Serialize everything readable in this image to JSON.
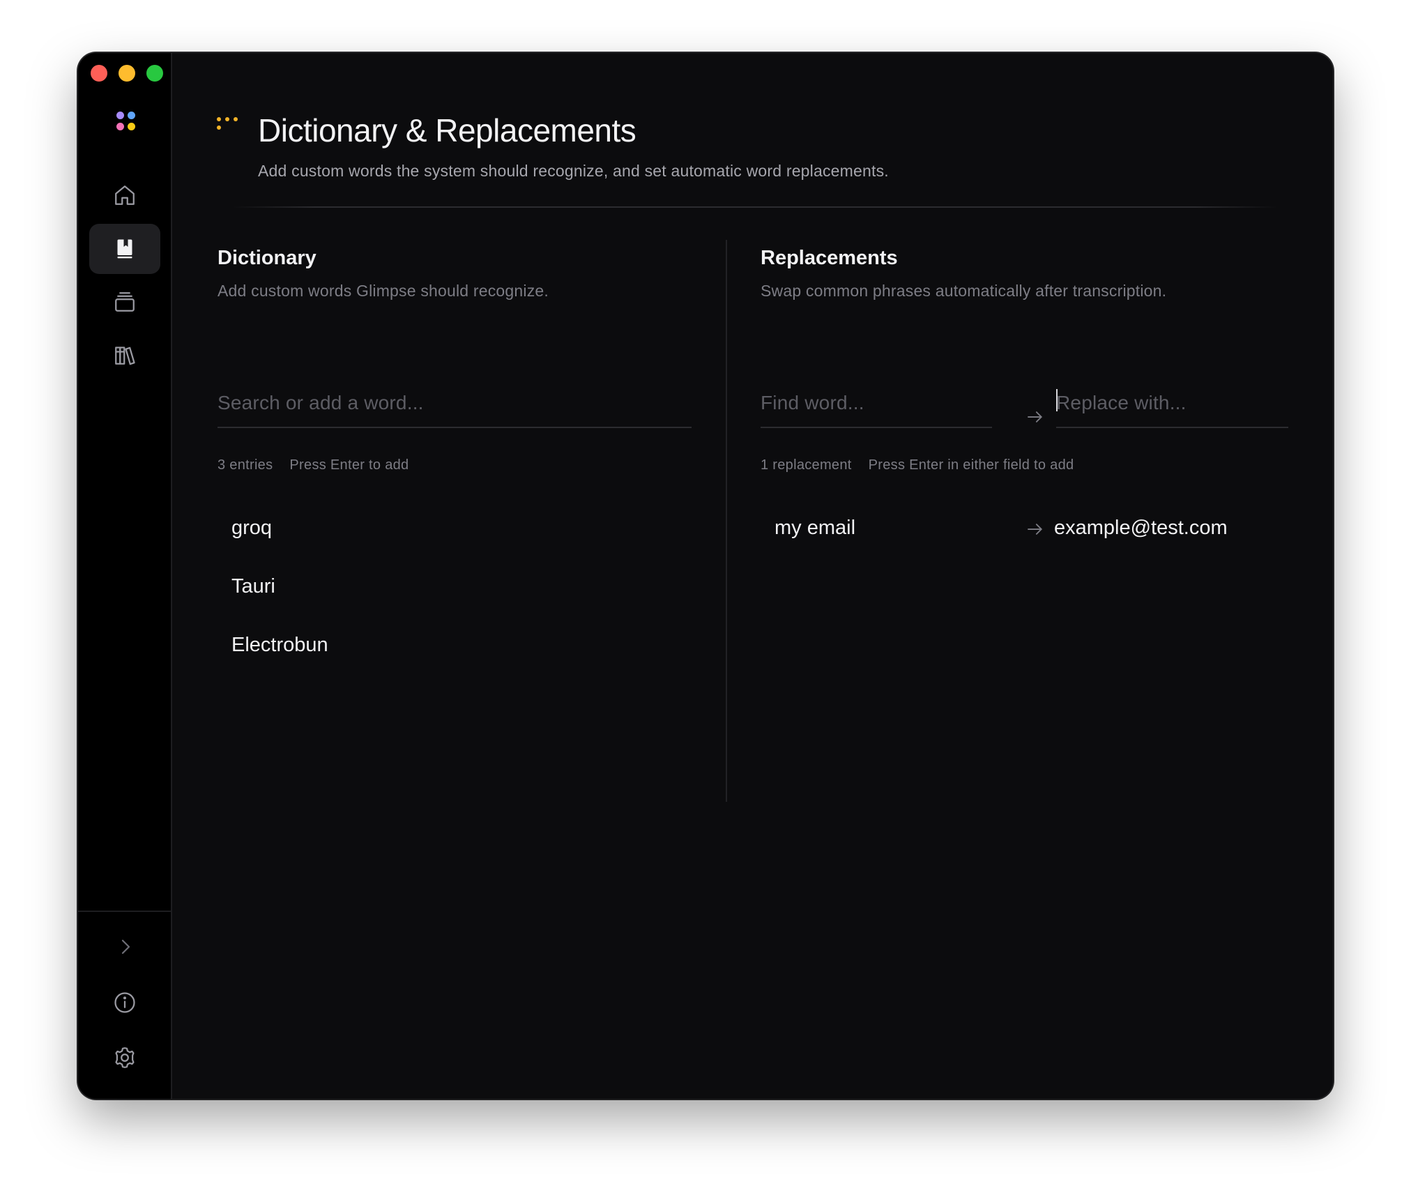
{
  "header": {
    "title": "Dictionary & Replacements",
    "subtitle": "Add custom words the system should recognize, and set automatic word replacements."
  },
  "colors": {
    "accent": "#f4b428",
    "brand_dots": [
      "#a78bfa",
      "#60a5fa",
      "#f472b6",
      "#facc15"
    ]
  },
  "sidebar": {
    "items": [
      {
        "icon": "home-icon",
        "label": "Home"
      },
      {
        "icon": "dictionary-icon",
        "label": "Dictionary",
        "active": true
      },
      {
        "icon": "layers-icon",
        "label": "History"
      },
      {
        "icon": "library-icon",
        "label": "Library"
      }
    ],
    "footer": [
      {
        "icon": "chevron-right-icon"
      },
      {
        "icon": "info-icon"
      },
      {
        "icon": "gear-icon"
      }
    ]
  },
  "dictionary": {
    "title": "Dictionary",
    "description": "Add custom words Glimpse should recognize.",
    "search_placeholder": "Search or add a word...",
    "entry_count": "3 entries",
    "hint": "Press Enter to add",
    "entries": [
      "groq",
      "Tauri",
      "Electrobun"
    ]
  },
  "replacements": {
    "title": "Replacements",
    "description": "Swap common phrases automatically after transcription.",
    "find_placeholder": "Find word...",
    "replace_placeholder": "Replace with...",
    "count": "1 replacement",
    "hint": "Press Enter in either field to add",
    "items": [
      {
        "find": "my email",
        "replace": "example@test.com"
      }
    ]
  }
}
